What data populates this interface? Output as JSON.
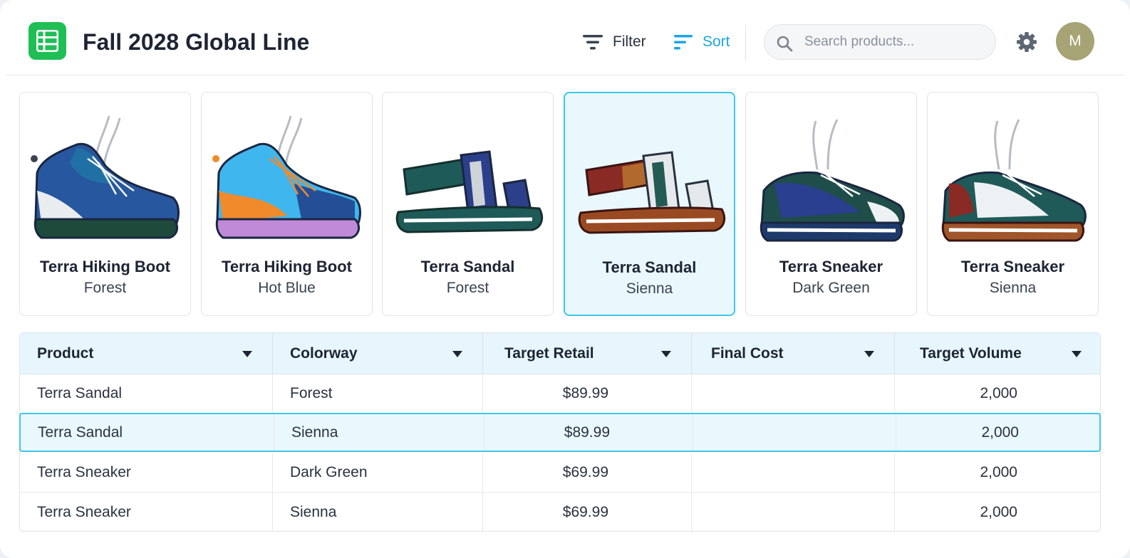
{
  "app": {
    "title": "Fall 2028 Global Line",
    "icon": "spreadsheet-icon",
    "accent": "#1aa6e4",
    "brand": "#1fbf55"
  },
  "toolbar": {
    "filter_label": "Filter",
    "sort_label": "Sort",
    "search_placeholder": "Search products...",
    "avatar_initial": "M"
  },
  "cards": [
    {
      "name": "Terra Hiking Boot",
      "colorway": "Forest",
      "icon": "hiking-boot-icon",
      "selected": false
    },
    {
      "name": "Terra Hiking Boot",
      "colorway": "Hot Blue",
      "icon": "hiking-boot-icon",
      "selected": false
    },
    {
      "name": "Terra Sandal",
      "colorway": "Forest",
      "icon": "sandal-icon",
      "selected": false
    },
    {
      "name": "Terra Sandal",
      "colorway": "Sienna",
      "icon": "sandal-icon",
      "selected": true
    },
    {
      "name": "Terra Sneaker",
      "colorway": "Dark Green",
      "icon": "sneaker-icon",
      "selected": false
    },
    {
      "name": "Terra Sneaker",
      "colorway": "Sienna",
      "icon": "sneaker-icon",
      "selected": false
    }
  ],
  "table": {
    "columns": [
      "Product",
      "Colorway",
      "Target Retail",
      "Final Cost",
      "Target Volume"
    ],
    "rows": [
      {
        "product": "Terra Sandal",
        "colorway": "Forest",
        "retail": "$89.99",
        "cost": "",
        "volume": "2,000",
        "selected": false
      },
      {
        "product": "Terra Sandal",
        "colorway": "Sienna",
        "retail": "$89.99",
        "cost": "",
        "volume": "2,000",
        "selected": true
      },
      {
        "product": "Terra Sneaker",
        "colorway": "Dark Green",
        "retail": "$69.99",
        "cost": "",
        "volume": "2,000",
        "selected": false
      },
      {
        "product": "Terra Sneaker",
        "colorway": "Sienna",
        "retail": "$69.99",
        "cost": "",
        "volume": "2,000",
        "selected": false
      }
    ]
  }
}
